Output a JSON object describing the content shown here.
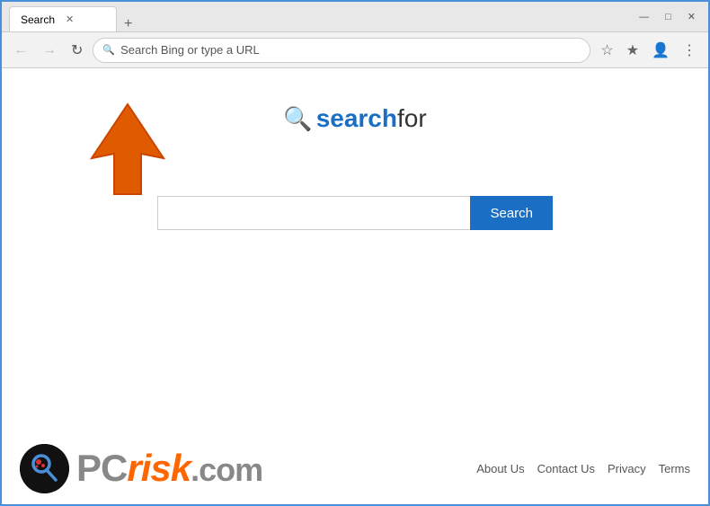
{
  "browser": {
    "tab_title": "Search",
    "new_tab_label": "+",
    "address_placeholder": "Search Bing or type a URL",
    "window_controls": {
      "minimize": "—",
      "maximize": "□",
      "close": "✕"
    }
  },
  "toolbar": {
    "back_label": "←",
    "forward_label": "→",
    "refresh_label": "↻",
    "favorites_icon": "☆",
    "extensions_icon": "★",
    "profile_icon": "👤",
    "menu_icon": "⋮"
  },
  "page": {
    "logo": {
      "icon": "🔍",
      "text_search": "search",
      "text_for": "for"
    },
    "search": {
      "input_placeholder": "",
      "button_label": "Search"
    }
  },
  "footer": {
    "links": [
      {
        "label": "About Us"
      },
      {
        "label": "Contact Us"
      },
      {
        "label": "Privacy"
      },
      {
        "label": "Terms"
      }
    ],
    "pcrisk": {
      "pc": "PC",
      "risk": "risk",
      "dotcom": ".com"
    }
  }
}
